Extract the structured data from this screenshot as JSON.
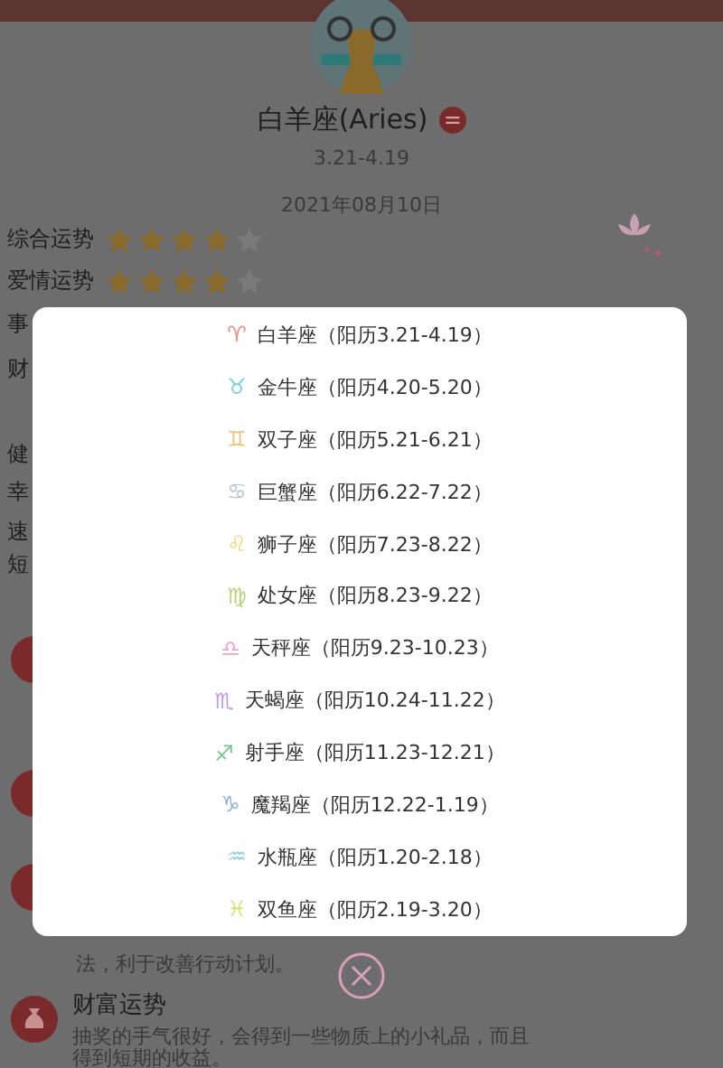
{
  "sign": {
    "title": "白羊座(Aries)",
    "range": "3.21-4.19",
    "date": "2021年08月10日"
  },
  "ratings": [
    {
      "label": "综合运势",
      "stars": 4
    },
    {
      "label": "爱情运势",
      "stars": 4
    }
  ],
  "side_labels": [
    "事",
    "财",
    "健",
    "幸",
    "速",
    "短"
  ],
  "partial_text": "法，利于改善行动计划。",
  "wealth": {
    "title": "财富运势",
    "lines": [
      "抽奖的手气很好，会得到一些物质上的小礼品，而且",
      "得到短期的收益。"
    ]
  },
  "picker": {
    "items": [
      {
        "symbol": "♈",
        "label": "白羊座（阳历3.21-4.19）",
        "color": "#f08a7a"
      },
      {
        "symbol": "♉",
        "label": "金牛座（阳历4.20-5.20）",
        "color": "#7ccfe0"
      },
      {
        "symbol": "♊",
        "label": "双子座（阳历5.21-6.21）",
        "color": "#f2c27a"
      },
      {
        "symbol": "♋",
        "label": "巨蟹座（阳历6.22-7.22）",
        "color": "#b8c4c8"
      },
      {
        "symbol": "♌",
        "label": "狮子座（阳历7.23-8.22）",
        "color": "#f2d870"
      },
      {
        "symbol": "♍",
        "label": "处女座（阳历8.23-9.22）",
        "color": "#b8d47a"
      },
      {
        "symbol": "♎",
        "label": "天秤座（阳历9.23-10.23）",
        "color": "#f2a0c8"
      },
      {
        "symbol": "♏",
        "label": "天蝎座（阳历10.24-11.22）",
        "color": "#c89ae0"
      },
      {
        "symbol": "♐",
        "label": "射手座（阳历11.23-12.21）",
        "color": "#7ac88a"
      },
      {
        "symbol": "♑",
        "label": "魔羯座（阳历12.22-1.19）",
        "color": "#8ab0e0"
      },
      {
        "symbol": "♒",
        "label": "水瓶座（阳历1.20-2.18）",
        "color": "#8ad0e0"
      },
      {
        "symbol": "♓",
        "label": "双鱼座（阳历2.19-3.20）",
        "color": "#d8e070"
      }
    ]
  }
}
